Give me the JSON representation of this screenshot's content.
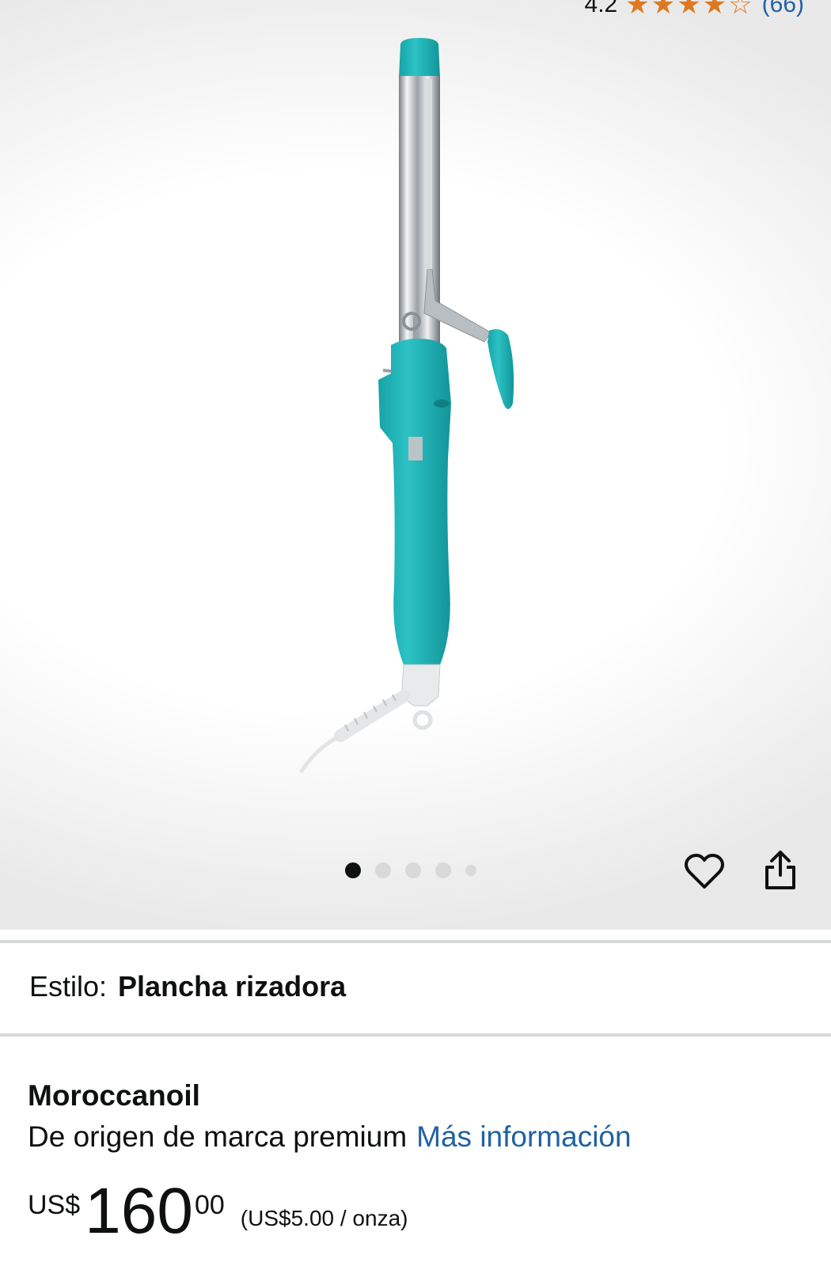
{
  "rating": {
    "value": "4.2",
    "stars": "★★★★☆",
    "count": "(66)"
  },
  "carousel": {
    "total_dots": 5,
    "active_index": 0
  },
  "actions": {
    "wishlist_icon": "heart-outline-icon",
    "share_icon": "share-icon"
  },
  "style": {
    "label": "Estilo:",
    "value": "Plancha rizadora"
  },
  "brand": {
    "name": "Moroccanoil",
    "description": "De origen de marca premium",
    "more_info_link": "Más información"
  },
  "price": {
    "symbol": "US$",
    "whole": "160",
    "fraction": "00",
    "unit_price": "(US$5.00 / onza)"
  },
  "colors": {
    "accent_link": "#2162a1",
    "star": "#de7921",
    "product_teal": "#1fb2b6"
  }
}
